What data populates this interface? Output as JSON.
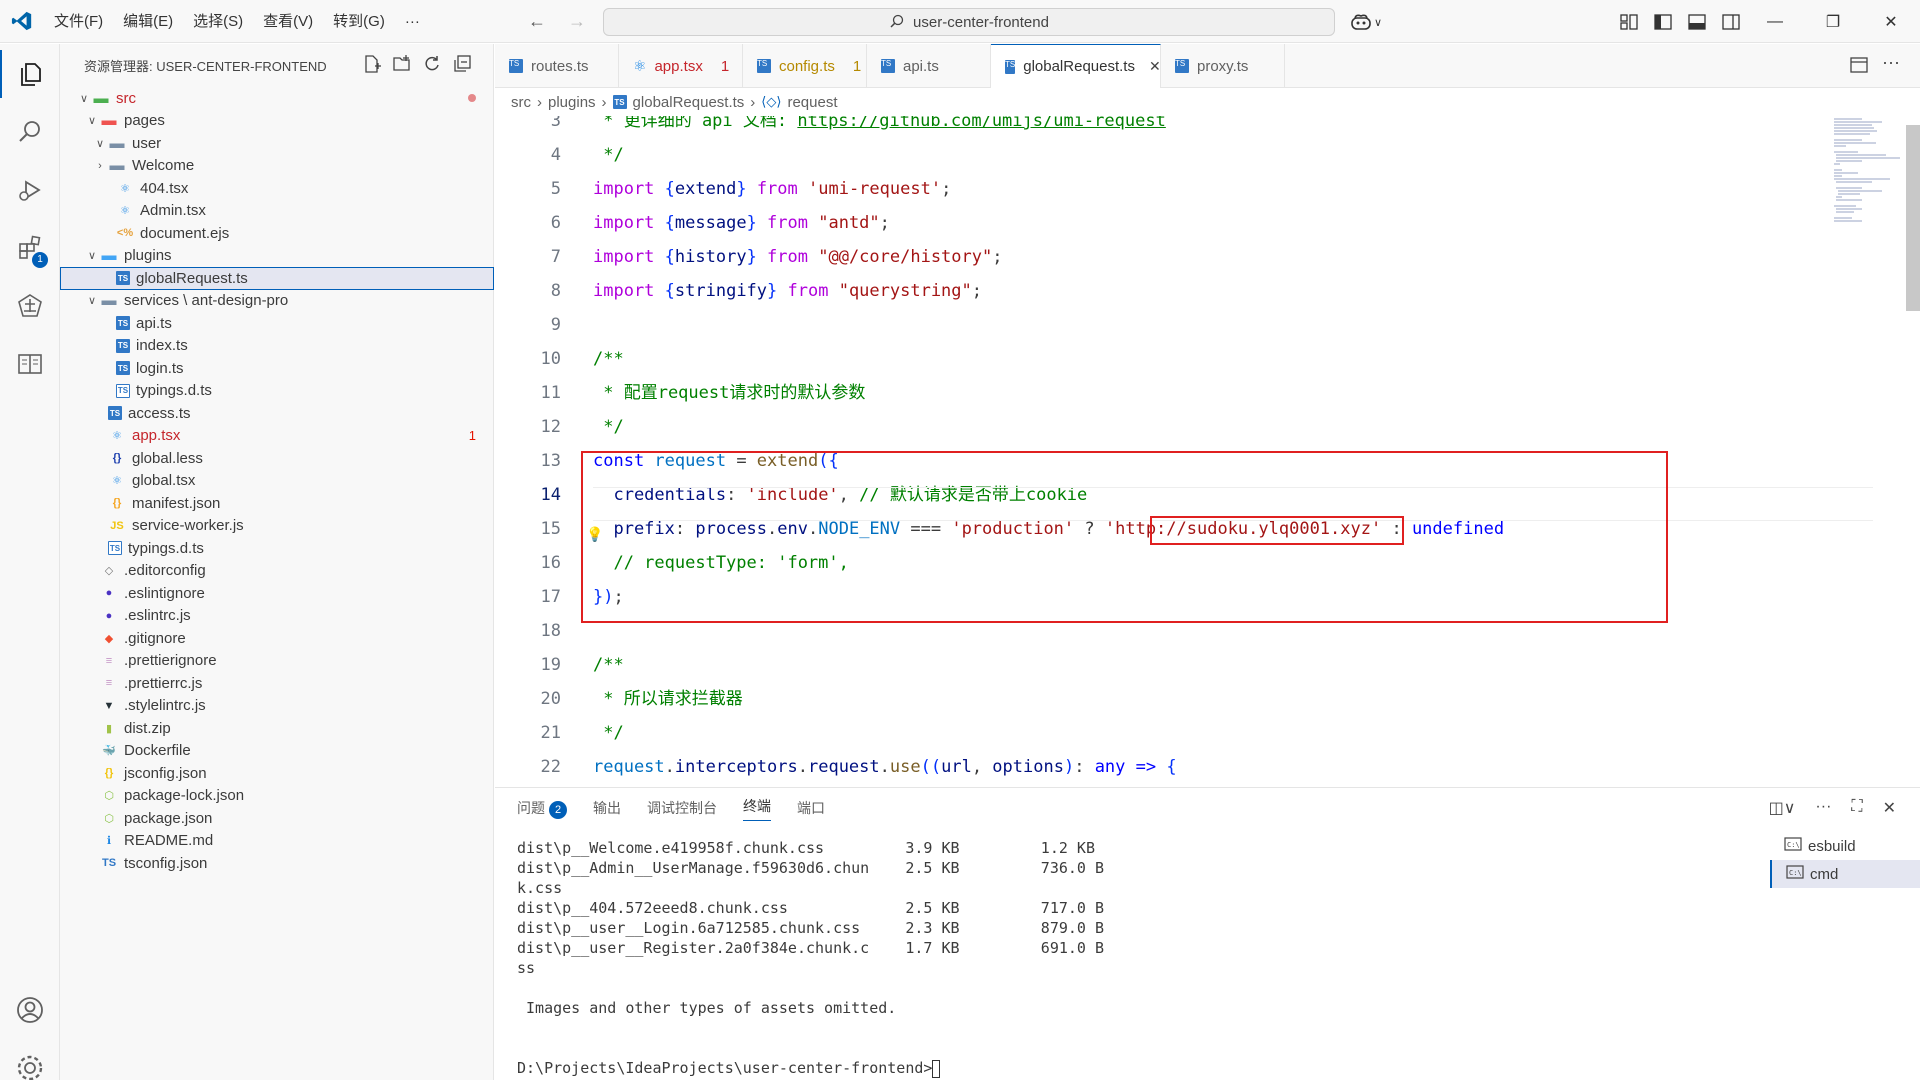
{
  "titlebar": {
    "menus": [
      "文件(F)",
      "编辑(E)",
      "选择(S)",
      "查看(V)",
      "转到(G)",
      "···"
    ],
    "search_text": "user-center-frontend"
  },
  "activity": {
    "extensions_badge": "1"
  },
  "explorer": {
    "title": "资源管理器: USER-CENTER-FRONTEND",
    "items": [
      {
        "label": "src",
        "indent": 1,
        "chev": "open",
        "icon": "folder-src",
        "color": "#c5262c",
        "dot": true
      },
      {
        "label": "pages",
        "indent": 2,
        "chev": "open",
        "icon": "folder-pages"
      },
      {
        "label": "user",
        "indent": 3,
        "chev": "open",
        "icon": "folder"
      },
      {
        "label": "Welcome",
        "indent": 3,
        "chev": "closed",
        "icon": "folder"
      },
      {
        "label": "404.tsx",
        "indent": 4,
        "icon": "react"
      },
      {
        "label": "Admin.tsx",
        "indent": 4,
        "icon": "react"
      },
      {
        "label": "document.ejs",
        "indent": 4,
        "icon": "ejs"
      },
      {
        "label": "plugins",
        "indent": 2,
        "chev": "open",
        "icon": "folder-plugins"
      },
      {
        "label": "globalRequest.ts",
        "indent": 4,
        "icon": "ts",
        "selected": true
      },
      {
        "label": "services \\ ant-design-pro",
        "indent": 2,
        "chev": "open",
        "icon": "folder"
      },
      {
        "label": "api.ts",
        "indent": 4,
        "icon": "ts"
      },
      {
        "label": "index.ts",
        "indent": 4,
        "icon": "ts"
      },
      {
        "label": "login.ts",
        "indent": 4,
        "icon": "ts"
      },
      {
        "label": "typings.d.ts",
        "indent": 4,
        "icon": "ts-outline"
      },
      {
        "label": "access.ts",
        "indent": 3,
        "icon": "ts"
      },
      {
        "label": "app.tsx",
        "indent": 3,
        "icon": "react",
        "color": "#c5262c",
        "count": "1"
      },
      {
        "label": "global.less",
        "indent": 3,
        "icon": "less"
      },
      {
        "label": "global.tsx",
        "indent": 3,
        "icon": "react"
      },
      {
        "label": "manifest.json",
        "indent": 3,
        "icon": "json"
      },
      {
        "label": "service-worker.js",
        "indent": 3,
        "icon": "js"
      },
      {
        "label": "typings.d.ts",
        "indent": 3,
        "icon": "ts-outline"
      },
      {
        "label": ".editorconfig",
        "indent": 2,
        "icon": "editorconfig"
      },
      {
        "label": ".eslintignore",
        "indent": 2,
        "icon": "eslint"
      },
      {
        "label": ".eslintrc.js",
        "indent": 2,
        "icon": "eslint"
      },
      {
        "label": ".gitignore",
        "indent": 2,
        "icon": "git"
      },
      {
        "label": ".prettierignore",
        "indent": 2,
        "icon": "prettier"
      },
      {
        "label": ".prettierrc.js",
        "indent": 2,
        "icon": "prettier"
      },
      {
        "label": ".stylelintrc.js",
        "indent": 2,
        "icon": "stylelint"
      },
      {
        "label": "dist.zip",
        "indent": 2,
        "icon": "zip"
      },
      {
        "label": "Dockerfile",
        "indent": 2,
        "icon": "docker"
      },
      {
        "label": "jsconfig.json",
        "indent": 2,
        "icon": "jsconfig"
      },
      {
        "label": "package-lock.json",
        "indent": 2,
        "icon": "npm"
      },
      {
        "label": "package.json",
        "indent": 2,
        "icon": "npm"
      },
      {
        "label": "README.md",
        "indent": 2,
        "icon": "info"
      },
      {
        "label": "tsconfig.json",
        "indent": 2,
        "icon": "tsconfig"
      }
    ]
  },
  "tabs": [
    {
      "label": "routes.ts",
      "icon": "ts"
    },
    {
      "label": "app.tsx",
      "icon": "react",
      "modified": "1",
      "color": "#c5262c"
    },
    {
      "label": "config.ts",
      "icon": "ts",
      "modified": "1",
      "color": "#b58900"
    },
    {
      "label": "api.ts",
      "icon": "ts"
    },
    {
      "label": "globalRequest.ts",
      "icon": "ts",
      "active": true
    },
    {
      "label": "proxy.ts",
      "icon": "ts"
    }
  ],
  "breadcrumb": [
    "src",
    "plugins",
    "globalRequest.ts",
    "request"
  ],
  "code": {
    "line_numbers": [
      "3",
      "4",
      "5",
      "6",
      "7",
      "8",
      "9",
      "10",
      "11",
      "12",
      "13",
      "14",
      "15",
      "16",
      "17",
      "18",
      "19",
      "20",
      "21",
      "22"
    ],
    "current_line": "14",
    "lines": [
      [
        {
          "t": " * 更详细的 api 文档: ",
          "c": "cmt"
        },
        {
          "t": "https://github.com/umijs/umi-request",
          "c": "cmt link"
        }
      ],
      [
        {
          "t": " */",
          "c": "cmt"
        }
      ],
      [
        {
          "t": "import ",
          "c": "kw2"
        },
        {
          "t": "{",
          "c": "brk"
        },
        {
          "t": "extend",
          "c": "var"
        },
        {
          "t": "}",
          "c": "brk"
        },
        {
          "t": " from ",
          "c": "kw2"
        },
        {
          "t": "'umi-request'",
          "c": "str"
        },
        {
          "t": ";",
          "c": ""
        }
      ],
      [
        {
          "t": "import ",
          "c": "kw2"
        },
        {
          "t": "{",
          "c": "brk"
        },
        {
          "t": "message",
          "c": "var"
        },
        {
          "t": "}",
          "c": "brk"
        },
        {
          "t": " from ",
          "c": "kw2"
        },
        {
          "t": "\"antd\"",
          "c": "str"
        },
        {
          "t": ";",
          "c": ""
        }
      ],
      [
        {
          "t": "import ",
          "c": "kw2"
        },
        {
          "t": "{",
          "c": "brk"
        },
        {
          "t": "history",
          "c": "var"
        },
        {
          "t": "}",
          "c": "brk"
        },
        {
          "t": " from ",
          "c": "kw2"
        },
        {
          "t": "\"@@/core/history\"",
          "c": "str"
        },
        {
          "t": ";",
          "c": ""
        }
      ],
      [
        {
          "t": "import ",
          "c": "kw2"
        },
        {
          "t": "{",
          "c": "brk"
        },
        {
          "t": "stringify",
          "c": "var"
        },
        {
          "t": "}",
          "c": "brk"
        },
        {
          "t": " from ",
          "c": "kw2"
        },
        {
          "t": "\"querystring\"",
          "c": "str"
        },
        {
          "t": ";",
          "c": ""
        }
      ],
      [],
      [
        {
          "t": "/**",
          "c": "cmt"
        }
      ],
      [
        {
          "t": " * 配置request请求时的默认参数",
          "c": "cmt"
        }
      ],
      [
        {
          "t": " */",
          "c": "cmt"
        }
      ],
      [
        {
          "t": "const ",
          "c": "kw"
        },
        {
          "t": "request",
          "c": "cst"
        },
        {
          "t": " = ",
          "c": ""
        },
        {
          "t": "extend",
          "c": "fn"
        },
        {
          "t": "({",
          "c": "brk"
        }
      ],
      [
        {
          "t": "  credentials",
          "c": "var"
        },
        {
          "t": ": ",
          "c": ""
        },
        {
          "t": "'include'",
          "c": "str"
        },
        {
          "t": ", ",
          "c": ""
        },
        {
          "t": "// 默认请求是否带上cookie",
          "c": "cmt"
        }
      ],
      [
        {
          "t": "  prefix",
          "c": "var"
        },
        {
          "t": ": ",
          "c": ""
        },
        {
          "t": "process",
          "c": "var"
        },
        {
          "t": ".",
          "c": ""
        },
        {
          "t": "env",
          "c": "var"
        },
        {
          "t": ".",
          "c": ""
        },
        {
          "t": "NODE_ENV",
          "c": "cst"
        },
        {
          "t": " === ",
          "c": ""
        },
        {
          "t": "'production'",
          "c": "str"
        },
        {
          "t": " ? ",
          "c": ""
        },
        {
          "t": "'http://sudoku.ylq0001.xyz'",
          "c": "str"
        },
        {
          "t": " : ",
          "c": ""
        },
        {
          "t": "undefined",
          "c": "kw"
        }
      ],
      [
        {
          "t": "  // requestType: 'form',",
          "c": "cmt"
        }
      ],
      [
        {
          "t": "})",
          "c": "brk"
        },
        {
          "t": ";",
          "c": ""
        }
      ],
      [],
      [
        {
          "t": "/**",
          "c": "cmt"
        }
      ],
      [
        {
          "t": " * 所以请求拦截器",
          "c": "cmt"
        }
      ],
      [
        {
          "t": " */",
          "c": "cmt"
        }
      ],
      [
        {
          "t": "request",
          "c": "cst"
        },
        {
          "t": ".",
          "c": ""
        },
        {
          "t": "interceptors",
          "c": "var"
        },
        {
          "t": ".",
          "c": ""
        },
        {
          "t": "request",
          "c": "var"
        },
        {
          "t": ".",
          "c": ""
        },
        {
          "t": "use",
          "c": "fn"
        },
        {
          "t": "((",
          "c": "brk"
        },
        {
          "t": "url",
          "c": "var"
        },
        {
          "t": ", ",
          "c": ""
        },
        {
          "t": "options",
          "c": "var"
        },
        {
          "t": ")",
          "c": "brk"
        },
        {
          "t": ": ",
          "c": ""
        },
        {
          "t": "any",
          "c": "kw"
        },
        {
          "t": " => ",
          "c": "kw"
        },
        {
          "t": "{",
          "c": "brk"
        }
      ]
    ]
  },
  "panel": {
    "tabs": [
      {
        "label": "问题",
        "badge": "2"
      },
      {
        "label": "输出"
      },
      {
        "label": "调试控制台"
      },
      {
        "label": "终端",
        "active": true
      },
      {
        "label": "端口"
      }
    ],
    "terminal_lines": [
      "dist\\p__Welcome.e419958f.chunk.css         3.9 KB         1.2 KB",
      "dist\\p__Admin__UserManage.f59630d6.chun    2.5 KB         736.0 B",
      "k.css",
      "dist\\p__404.572eeed8.chunk.css             2.5 KB         717.0 B",
      "dist\\p__user__Login.6a712585.chunk.css     2.3 KB         879.0 B",
      "dist\\p__user__Register.2a0f384e.chunk.c    1.7 KB         691.0 B",
      "ss",
      "",
      " Images and other types of assets omitted.",
      "",
      "",
      "D:\\Projects\\IdeaProjects\\user-center-frontend>"
    ],
    "terminals": [
      {
        "label": "esbuild"
      },
      {
        "label": "cmd",
        "active": true
      }
    ]
  },
  "colors": {
    "accent": "#005fb8",
    "highlight_box": "#e02020",
    "error": "#c5262c"
  }
}
